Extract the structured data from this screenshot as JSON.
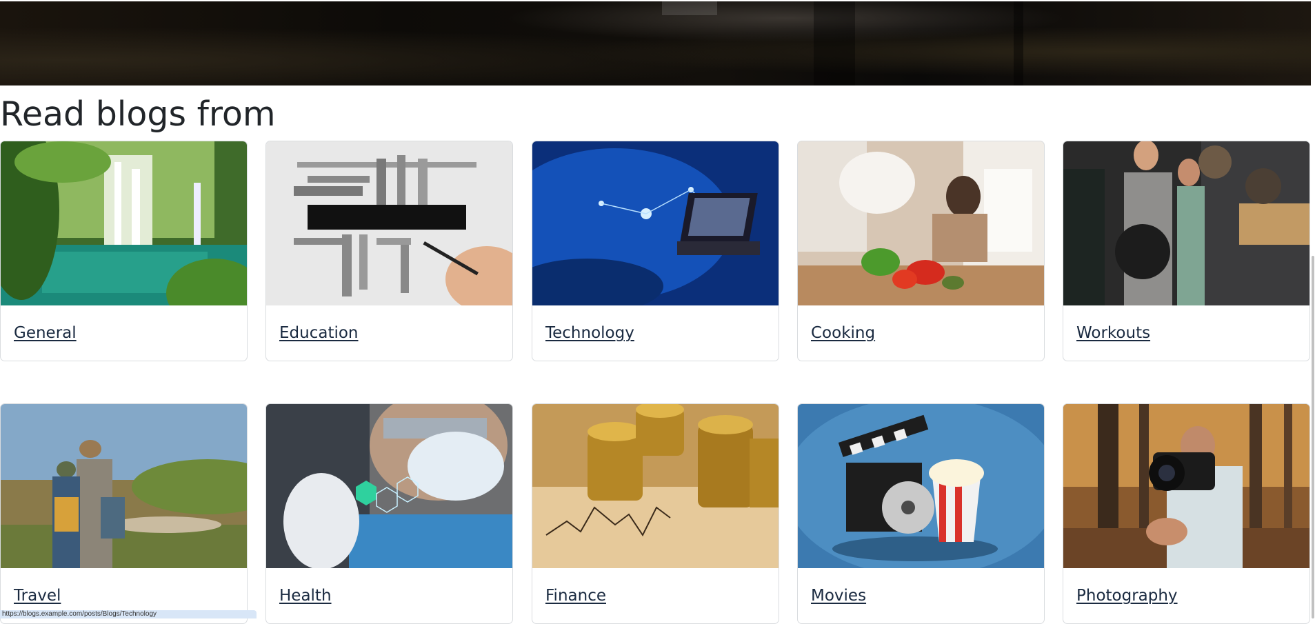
{
  "page": {
    "title": "Read blogs from"
  },
  "categories": [
    {
      "label": "General",
      "image": "waterfall-forest-image"
    },
    {
      "label": "Education",
      "image": "education-word-cloud-image"
    },
    {
      "label": "Technology",
      "image": "technology-network-laptop-image"
    },
    {
      "label": "Cooking",
      "image": "woman-cooking-kitchen-image"
    },
    {
      "label": "Workouts",
      "image": "couple-gym-weights-image"
    },
    {
      "label": "Travel",
      "image": "hikers-binoculars-image"
    },
    {
      "label": "Health",
      "image": "doctor-medical-hexagons-image"
    },
    {
      "label": "Finance",
      "image": "gold-coins-chart-image"
    },
    {
      "label": "Movies",
      "image": "clapperboard-popcorn-image"
    },
    {
      "label": "Photography",
      "image": "photographer-camera-forest-image"
    }
  ],
  "status_bar": {
    "url": "https://blogs.example.com/posts/Blogs/Technology"
  }
}
